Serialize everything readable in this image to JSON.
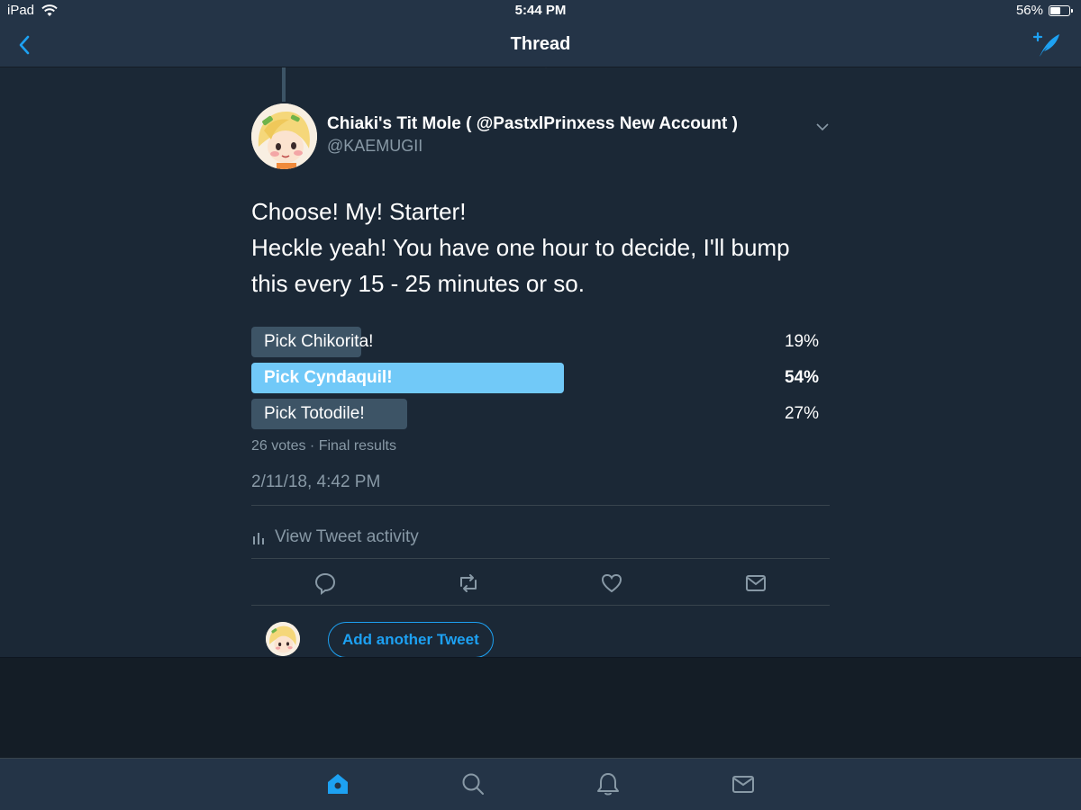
{
  "status_bar": {
    "device": "iPad",
    "time": "5:44 PM",
    "battery": "56%",
    "battery_level": 0.56
  },
  "nav": {
    "title": "Thread",
    "back_icon": "chevron-left-icon",
    "compose_icon": "compose-tweet-icon"
  },
  "tweet": {
    "author_name": "Chiaki's Tit Mole ( @PastxlPrinxess New Account )",
    "author_handle": "@KAEMUGII",
    "text_line1": "Choose! My! Starter!",
    "text_line2": "Heckle yeah! You have one hour to decide, I'll bump this every 15 - 25 minutes or so.",
    "poll": {
      "options": [
        {
          "label": "Pick Chikorita!",
          "percent_text": "19%",
          "percent": 19,
          "winner": false
        },
        {
          "label": "Pick Cyndaquil!",
          "percent_text": "54%",
          "percent": 54,
          "winner": true
        },
        {
          "label": "Pick Totodile!",
          "percent_text": "27%",
          "percent": 27,
          "winner": false
        }
      ],
      "meta": "26 votes · Final results"
    },
    "timestamp": "2/11/18, 4:42 PM",
    "activity_label": "View Tweet activity"
  },
  "reply": {
    "button_label": "Add another Tweet"
  },
  "tabs": [
    "home-icon",
    "search-icon",
    "notifications-icon",
    "messages-icon"
  ],
  "colors": {
    "background": "#1b2836",
    "bar": "#243447",
    "accent": "#1da1f2",
    "poll_winner": "#71c9f8",
    "poll_bar": "#3d5466",
    "muted": "#8899a6"
  }
}
